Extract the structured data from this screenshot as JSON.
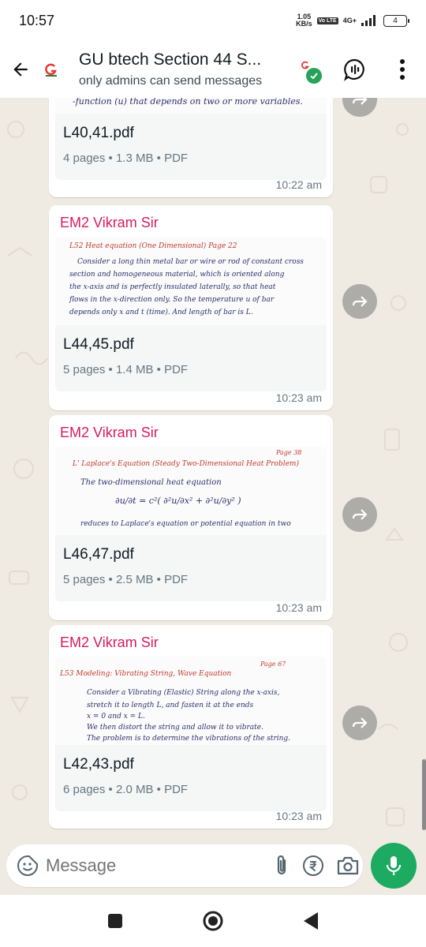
{
  "status": {
    "time": "10:57",
    "speed_value": "1.05",
    "speed_unit": "KB/s",
    "volte": "Vo LTE",
    "network": "4G+",
    "battery": "4"
  },
  "header": {
    "title": "GU btech Section 44 S...",
    "subtitle": "only admins can send messages"
  },
  "messages": [
    {
      "sender": "",
      "preview_lines": [
        "-function (u) that depends on two or more variables."
      ],
      "file_name": "L40,41.pdf",
      "meta": "4 pages • 1.3 MB • PDF",
      "time": "10:22 am"
    },
    {
      "sender": "EM2 Vikram Sir",
      "preview_lines": [
        "L52  Heat equation (One Dimensional)          Page 22",
        "Consider a long thin metal bar or wire or rod of constant cross",
        "section and homogeneous material, which is oriented along",
        "the x-axis and is perfectly insulated laterally, so that heat",
        "flows in the x-direction only. So the temperature u of bar",
        "depends only x and t (time). And length of bar is L."
      ],
      "file_name": "L44,45.pdf",
      "meta": "5 pages • 1.4 MB • PDF",
      "time": "10:23 am"
    },
    {
      "sender": "EM2 Vikram Sir",
      "preview_lines": [
        "Page 38",
        "L'   Laplace's Equation (Steady Two-Dimensional Heat Problem)",
        "The two-dimensional heat equation",
        "∂u/∂t = c²( ∂²u/∂x² + ∂²u/∂y² )",
        "reduces to Laplace's equation or potential equation in two"
      ],
      "file_name": "L46,47.pdf",
      "meta": "5 pages • 2.5 MB • PDF",
      "time": "10:23 am"
    },
    {
      "sender": "EM2 Vikram Sir",
      "preview_lines": [
        "Page 67",
        "L53  Modeling: Vibrating String, Wave Equation",
        "Consider a Vibrating (Elastic) String along the x-axis,",
        "stretch it to length L, and fasten it at the ends",
        "x = 0 and x = L.",
        "We then distort the string and allow it to vibrate.",
        "The problem is to determine the vibrations of the string."
      ],
      "file_name": "L42,43.pdf",
      "meta": "6 pages • 2.0 MB • PDF",
      "time": "10:23 am"
    }
  ],
  "composer": {
    "placeholder": "Message"
  },
  "colors": {
    "sender": "#d81b60",
    "mic": "#1daa61",
    "verified": "#25a35a"
  },
  "icons": [
    "back-arrow-icon",
    "group-avatar",
    "voice-chat-icon",
    "more-vert-icon",
    "forward-icon",
    "emoji-icon",
    "attach-icon",
    "rupee-icon",
    "camera-icon",
    "mic-icon",
    "square-icon",
    "circle-icon",
    "triangle-back-icon"
  ]
}
